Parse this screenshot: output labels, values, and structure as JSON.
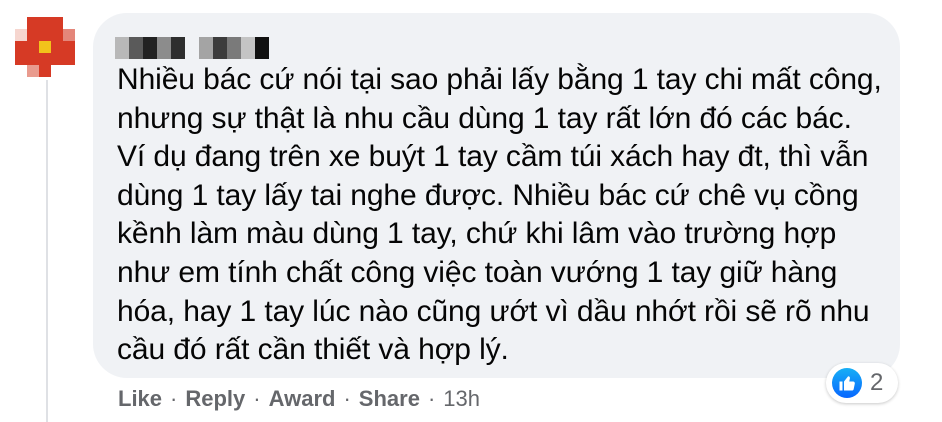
{
  "comment": {
    "text": "Nhiều bác cứ nói tại sao phải lấy bằng 1 tay chi mất công, nhưng sự thật là nhu cầu dùng 1 tay rất lớn đó các bác. Ví dụ đang trên xe buýt 1 tay cầm túi xách hay đt, thì vẫn dùng 1 tay lấy tai nghe được. Nhiều bác cứ chê vụ cồng kềnh làm màu dùng 1 tay, chứ khi lâm vào trường hợp như em tính chất công việc toàn vướng 1 tay giữ hàng hóa, hay 1 tay lúc nào cũng ướt vì dầu nhớt rồi sẽ rõ nhu cầu đó rất cần thiết và hợp lý."
  },
  "reaction": {
    "icon": "like-icon",
    "count": "2",
    "color": "#1877f2"
  },
  "actions": {
    "like": "Like",
    "reply": "Reply",
    "award": "Award",
    "share": "Share",
    "separator": "·",
    "time": "13h"
  },
  "colors": {
    "bubble": "#f0f2f5",
    "text": "#050505",
    "secondary": "#65676b",
    "avatar_red": "#d63a25",
    "avatar_yellow": "#f2c21b"
  }
}
